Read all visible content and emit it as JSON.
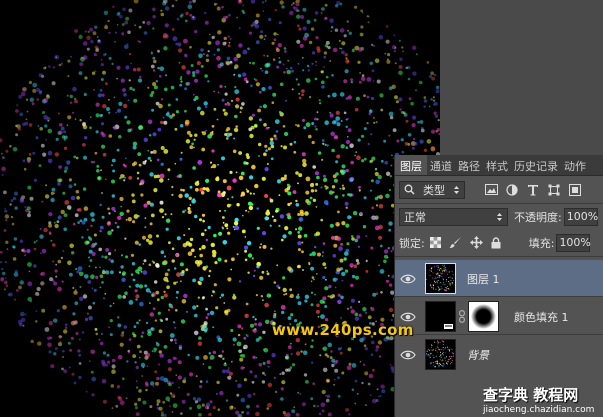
{
  "panel": {
    "tabs": [
      "图层",
      "通道",
      "路径",
      "样式",
      "历史记录",
      "动作"
    ],
    "filter": {
      "label": "类型"
    },
    "blend_mode": "正常",
    "opacity_label": "不透明度:",
    "opacity_value": "100%",
    "lock_label": "锁定:",
    "fill_label": "填充:",
    "fill_value": "100%",
    "layers": [
      {
        "name": "图层 1",
        "selected": true,
        "visible": true
      },
      {
        "name": "颜色填充 1",
        "selected": false,
        "visible": true
      },
      {
        "name": "背景",
        "selected": false,
        "visible": true
      }
    ]
  },
  "watermark": "www.240ps.com",
  "logo": {
    "main": "查字典 教程网",
    "sub": "jiaocheng.chazidian.com"
  },
  "colors": {
    "panel_bg": "#535353",
    "selected_layer": "#5d6d85",
    "watermark": "#f5c70c",
    "particles": [
      "#ff3dd8",
      "#c93cff",
      "#6b4cff",
      "#3d7bff",
      "#35e7ff",
      "#39ff6a",
      "#f7ff3a",
      "#ffd13a",
      "#ff4b4b",
      "#ffffff"
    ]
  }
}
